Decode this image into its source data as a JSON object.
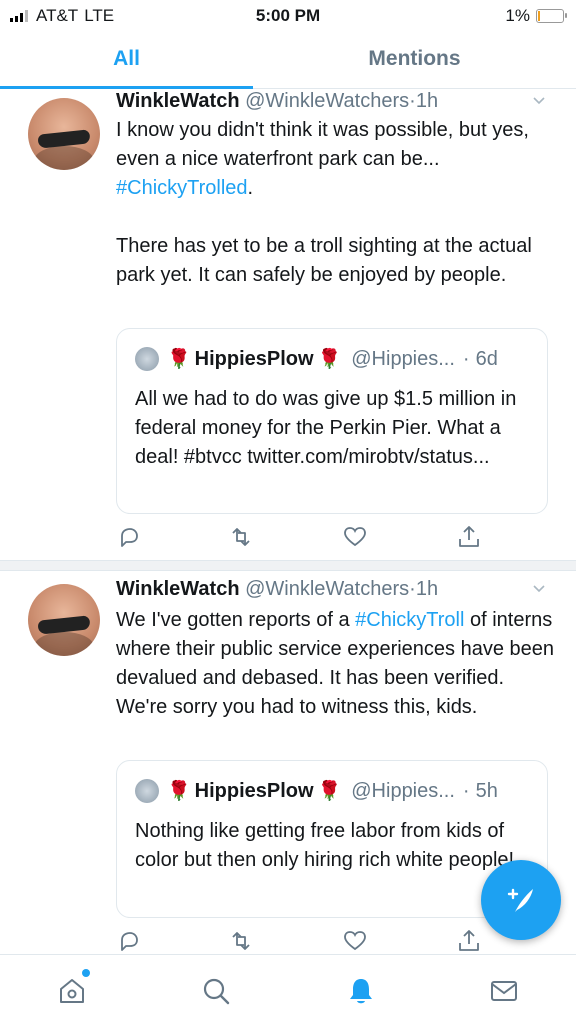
{
  "status_bar": {
    "carrier": "AT&T",
    "network": "LTE",
    "time": "5:00 PM",
    "battery_percent": "1%"
  },
  "tabs": [
    {
      "label": "All",
      "active": true
    },
    {
      "label": "Mentions",
      "active": false
    }
  ],
  "tweets": [
    {
      "name": "WinkleWatch",
      "handle": "@WinkleWatchers",
      "dot": "·",
      "time": "1h",
      "text_1": "I know you didn't think it was possible, but yes, even a nice waterfront park can be...",
      "hashtag_1": "#ChickyTrolled",
      "text_1_end": ".",
      "text_2": "There has yet to be a troll sighting at the actual park yet. It can safely be enjoyed by people.",
      "quote": {
        "name": "HippiesPlow",
        "handle": "@Hippies...",
        "dot": "·",
        "time": "6d",
        "text": "All we had to do was give up $1.5 million in federal money for the Perkin Pier. What a deal! #btvcc twitter.com/mirobtv/status..."
      }
    },
    {
      "name": "WinkleWatch",
      "handle": "@WinkleWatchers",
      "dot": "·",
      "time": "1h",
      "text_pre": "We I've gotten reports of a",
      "hashtag_1": "#ChickyTroll",
      "text_post": "of interns where their public service experiences have been devalued and debased. It has been verified. We're sorry you had to witness this, kids.",
      "quote": {
        "name": "HippiesPlow",
        "handle": "@Hippies...",
        "dot": "·",
        "time": "5h",
        "text": "Nothing like getting free labor from kids of color but then only hiring rich white people!"
      }
    }
  ],
  "icons": {
    "reply": "reply-icon",
    "retweet": "retweet-icon",
    "like": "heart-icon",
    "share": "share-icon",
    "compose": "compose-tweet-icon",
    "home": "home-icon",
    "search": "search-icon",
    "notifications": "notifications-bell-icon",
    "messages": "mail-icon"
  },
  "colors": {
    "accent": "#1da1f2",
    "text": "#14171a",
    "muted": "#657786",
    "rose": "#c8102e"
  }
}
